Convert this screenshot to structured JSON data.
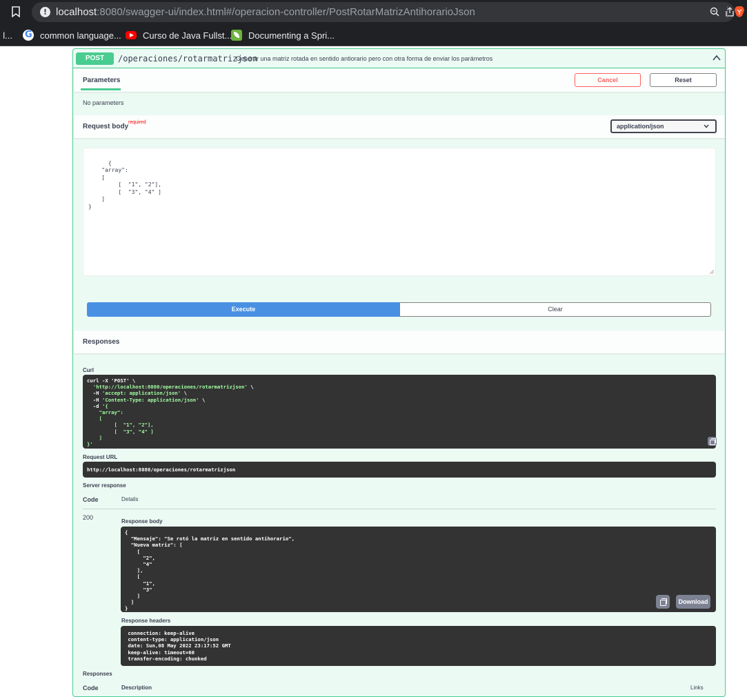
{
  "browser": {
    "url_host": "localhost",
    "url_rest": ":8080/swagger-ui/index.html#/operacion-controller/PostRotarMatrizAntihorarioJson",
    "bookmarks": [
      {
        "label": "common language...",
        "icon": "google-icon"
      },
      {
        "label": "Curso de Java Fullst...",
        "icon": "youtube-icon"
      },
      {
        "label": "Documenting a Spri...",
        "icon": "spring-icon"
      }
    ],
    "bookmark_fragment": ": l..."
  },
  "operation": {
    "method": "POST",
    "path": "/operaciones/rotarmatrizjson",
    "description": "Generar una matriz rotada en sentido antiorario pero con otra forma de enviar los parámetros"
  },
  "params": {
    "tab_label": "Parameters",
    "cancel_label": "Cancel",
    "reset_label": "Reset",
    "no_params": "No parameters"
  },
  "request_body": {
    "label": "Request body",
    "required": "required",
    "content_type": "application/json",
    "editor_text": "{\n    \"array\":\n    [\n         [  \"1\", \"2\"],\n         [  \"3\", \"4\" ]\n    ]\n}"
  },
  "actions": {
    "execute_label": "Execute",
    "clear_label": "Clear"
  },
  "responses": {
    "header": "Responses",
    "curl_label": "Curl",
    "curl_cmd": "curl -X 'POST' \\\n  ",
    "curl_url": "'http://localhost:8080/operaciones/rotarmatrizjson'",
    "curl_rest_1": " \\\n  -H ",
    "curl_accept": "'accept: application/json'",
    "curl_rest_2": " \\\n  -H ",
    "curl_ct": "'Content-Type: application/json'",
    "curl_rest_3": " \\\n  -d ",
    "curl_body": "'{\n    \"array\":\n    [\n         [  \"1\", \"2\"],\n         [  \"3\", \"4\" ]\n    ]\n}'",
    "request_url_label": "Request URL",
    "request_url": "http://localhost:8080/operaciones/rotarmatrizjson",
    "server_response_label": "Server response",
    "col_code": "Code",
    "col_details": "Details",
    "status_code": "200",
    "response_body_label": "Response body",
    "response_body_text": "{\n  \"Mensaje\": \"Se rotó la matriz en sentido antihorario\",\n  \"Nueva matriz\": [\n    [\n      \"2\",\n      \"4\"\n    ],\n    [\n      \"1\",\n      \"3\"\n    ]\n  ]\n}",
    "download_label": "Download",
    "response_headers_label": "Response headers",
    "response_headers_text": " connection: keep-alive \n content-type: application/json \n date: Sun,08 May 2022 23:17:52 GMT \n keep-alive: timeout=60 \n transfer-encoding: chunked ",
    "responses_label": "Responses",
    "col_description": "Description",
    "col_links": "Links"
  }
}
